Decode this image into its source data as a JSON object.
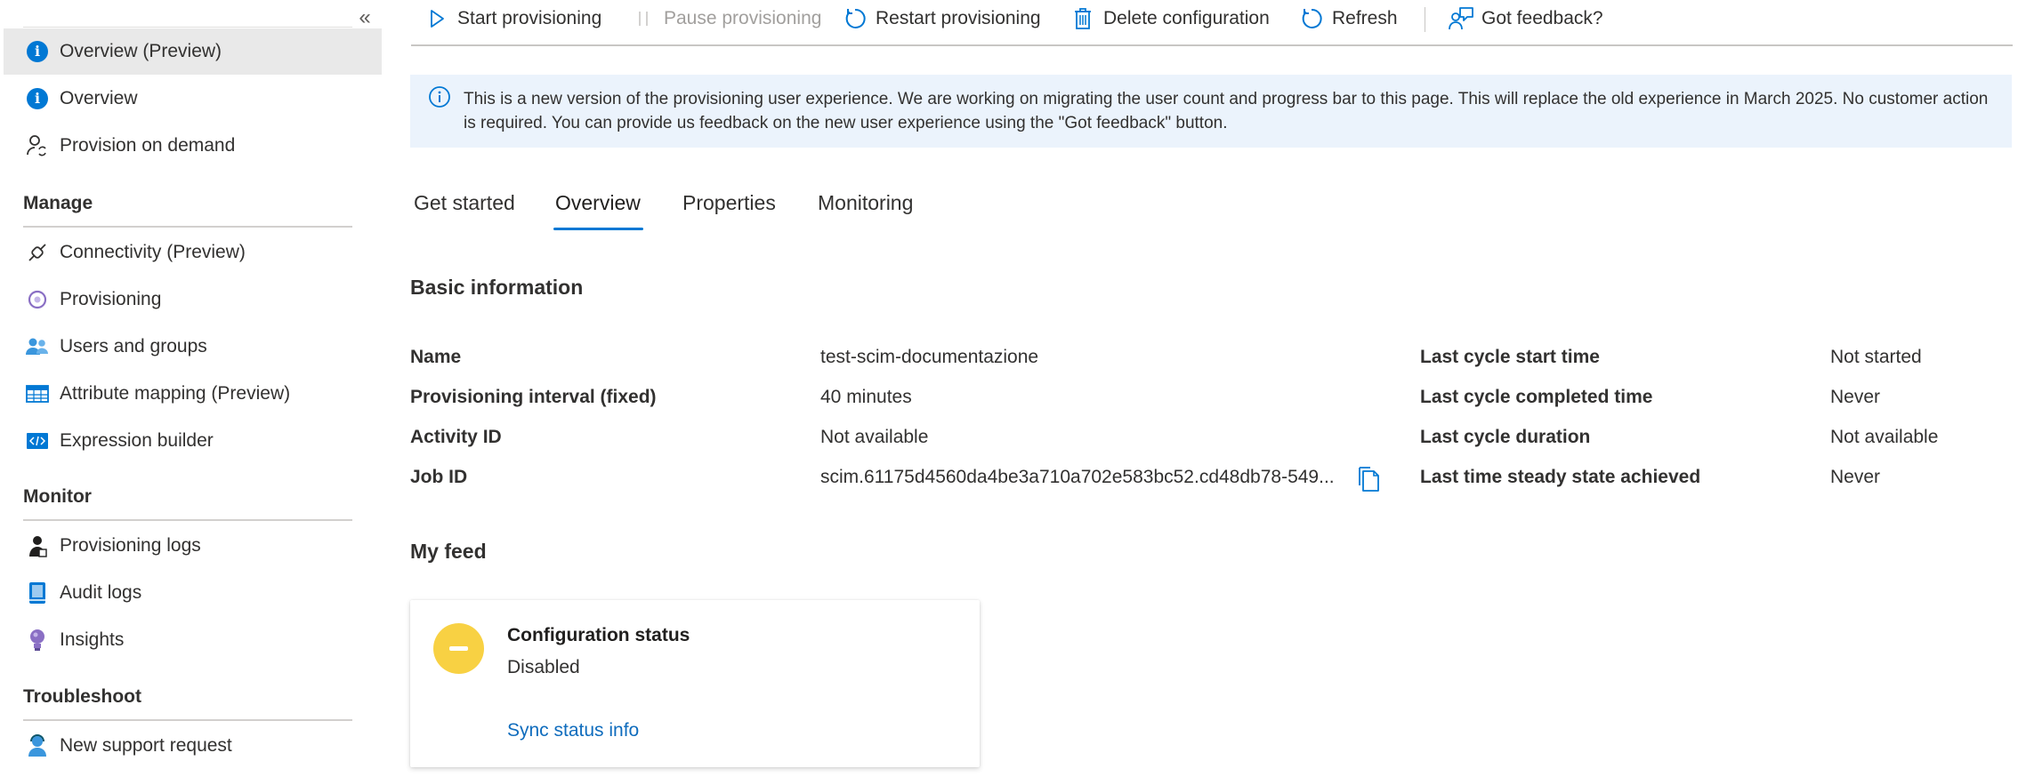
{
  "sidebar": {
    "collapse_glyph": "«",
    "items_top": [
      {
        "label": "Overview (Preview)",
        "icon": "info-icon",
        "selected": true
      },
      {
        "label": "Overview",
        "icon": "info-icon"
      },
      {
        "label": "Provision on demand",
        "icon": "person-sync-icon"
      }
    ],
    "sections": [
      {
        "title": "Manage",
        "items": [
          {
            "label": "Connectivity (Preview)",
            "icon": "plug-icon"
          },
          {
            "label": "Provisioning",
            "icon": "provisioning-icon"
          },
          {
            "label": "Users and groups",
            "icon": "users-icon"
          },
          {
            "label": "Attribute mapping (Preview)",
            "icon": "table-icon"
          },
          {
            "label": "Expression builder",
            "icon": "code-icon"
          }
        ]
      },
      {
        "title": "Monitor",
        "items": [
          {
            "label": "Provisioning logs",
            "icon": "person-log-icon"
          },
          {
            "label": "Audit logs",
            "icon": "book-icon"
          },
          {
            "label": "Insights",
            "icon": "lightbulb-icon"
          }
        ]
      },
      {
        "title": "Troubleshoot",
        "items": [
          {
            "label": "New support request",
            "icon": "support-icon"
          }
        ]
      }
    ]
  },
  "toolbar": {
    "start": "Start provisioning",
    "pause": "Pause provisioning",
    "restart": "Restart provisioning",
    "delete": "Delete configuration",
    "refresh": "Refresh",
    "feedback": "Got feedback?"
  },
  "banner": {
    "text": "This is a new version of the provisioning user experience. We are working on migrating the user count and progress bar to this page. This will replace the old experience in March 2025. No customer action is required. You can provide us feedback on the new user experience using the \"Got feedback\" button."
  },
  "tabs": [
    "Get started",
    "Overview",
    "Properties",
    "Monitoring"
  ],
  "active_tab": "Overview",
  "basic_info": {
    "title": "Basic information",
    "left": [
      {
        "label": "Name",
        "value": "test-scim-documentazione"
      },
      {
        "label": "Provisioning interval (fixed)",
        "value": "40 minutes"
      },
      {
        "label": "Activity ID",
        "value": "Not available"
      },
      {
        "label": "Job ID",
        "value": "scim.61175d4560da4be3a710a702e583bc52.cd48db78-549..."
      }
    ],
    "right": [
      {
        "label": "Last cycle start time",
        "value": "Not started"
      },
      {
        "label": "Last cycle completed time",
        "value": "Never"
      },
      {
        "label": "Last cycle duration",
        "value": "Not available"
      },
      {
        "label": "Last time steady state achieved",
        "value": "Never"
      }
    ]
  },
  "feed": {
    "title": "My feed",
    "card": {
      "title": "Configuration status",
      "value": "Disabled",
      "link": "Sync status info",
      "status_color": "#f8d143"
    }
  },
  "colors": {
    "accent": "#0078d4",
    "banner_bg": "#ebf3fc",
    "link": "#0f6cbd"
  }
}
